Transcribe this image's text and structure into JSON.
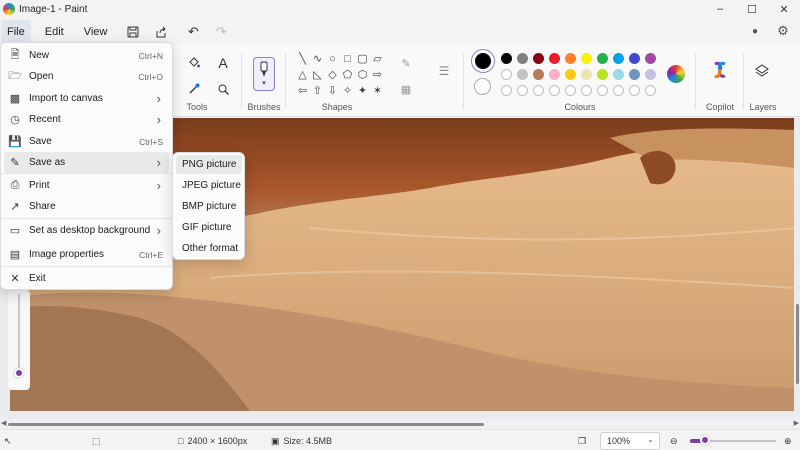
{
  "window": {
    "title": "Image-1 - Paint",
    "minimize_icon": "minimize-icon",
    "maximize_icon": "maximize-icon",
    "close_icon": "close-icon"
  },
  "menubar": {
    "file": "File",
    "edit": "Edit",
    "view": "View",
    "quick_actions": [
      "save-icon",
      "share-icon",
      "undo-icon",
      "redo-icon"
    ],
    "right_icons": [
      "account-icon",
      "settings-icon"
    ]
  },
  "ribbon": {
    "tools_label": "Tools",
    "brushes_label": "Brushes",
    "shapes_label": "Shapes",
    "colours_label": "Colours",
    "copilot_label": "Copilot",
    "layers_label": "Layers",
    "palette_row1": [
      "#000000",
      "#7f7f7f",
      "#880015",
      "#ed1c24",
      "#ff7f27",
      "#fff200",
      "#22b14c",
      "#00a2e8",
      "#3f48cc",
      "#a349a4"
    ],
    "palette_row2": [
      "#ffffff",
      "#c3c3c3",
      "#b97a57",
      "#ffaec9",
      "#ffc90e",
      "#efe4b0",
      "#b5e61d",
      "#99d9ea",
      "#7092be",
      "#c8bfe7"
    ],
    "primary_color": "#000000",
    "secondary_color": "#ffffff"
  },
  "file_menu": {
    "items": [
      {
        "label": "New",
        "shortcut": "Ctrl+N",
        "icon": "new-file-icon"
      },
      {
        "label": "Open",
        "shortcut": "Ctrl+O",
        "icon": "open-folder-icon"
      },
      {
        "label": "Import to canvas",
        "submenu": true,
        "icon": "import-icon"
      },
      {
        "label": "Recent",
        "submenu": true,
        "icon": "recent-icon"
      },
      {
        "label": "Save",
        "shortcut": "Ctrl+S",
        "icon": "save-icon"
      },
      {
        "label": "Save as",
        "submenu": true,
        "icon": "save-as-icon"
      },
      {
        "label": "Print",
        "submenu": true,
        "icon": "print-icon"
      },
      {
        "label": "Share",
        "icon": "share-icon"
      },
      {
        "label": "Set as desktop background",
        "submenu": true,
        "icon": "desktop-background-icon"
      },
      {
        "label": "Image properties",
        "shortcut": "Ctrl+E",
        "icon": "image-properties-icon"
      },
      {
        "label": "Exit",
        "icon": "exit-icon"
      }
    ]
  },
  "save_as_menu": {
    "items": [
      "PNG picture",
      "JPEG picture",
      "BMP picture",
      "GIF picture",
      "Other format"
    ]
  },
  "status": {
    "dimensions": "2400 × 1600px",
    "size": "Size: 4.5MB",
    "zoom": "100%",
    "zoom_fraction": 0.2
  }
}
